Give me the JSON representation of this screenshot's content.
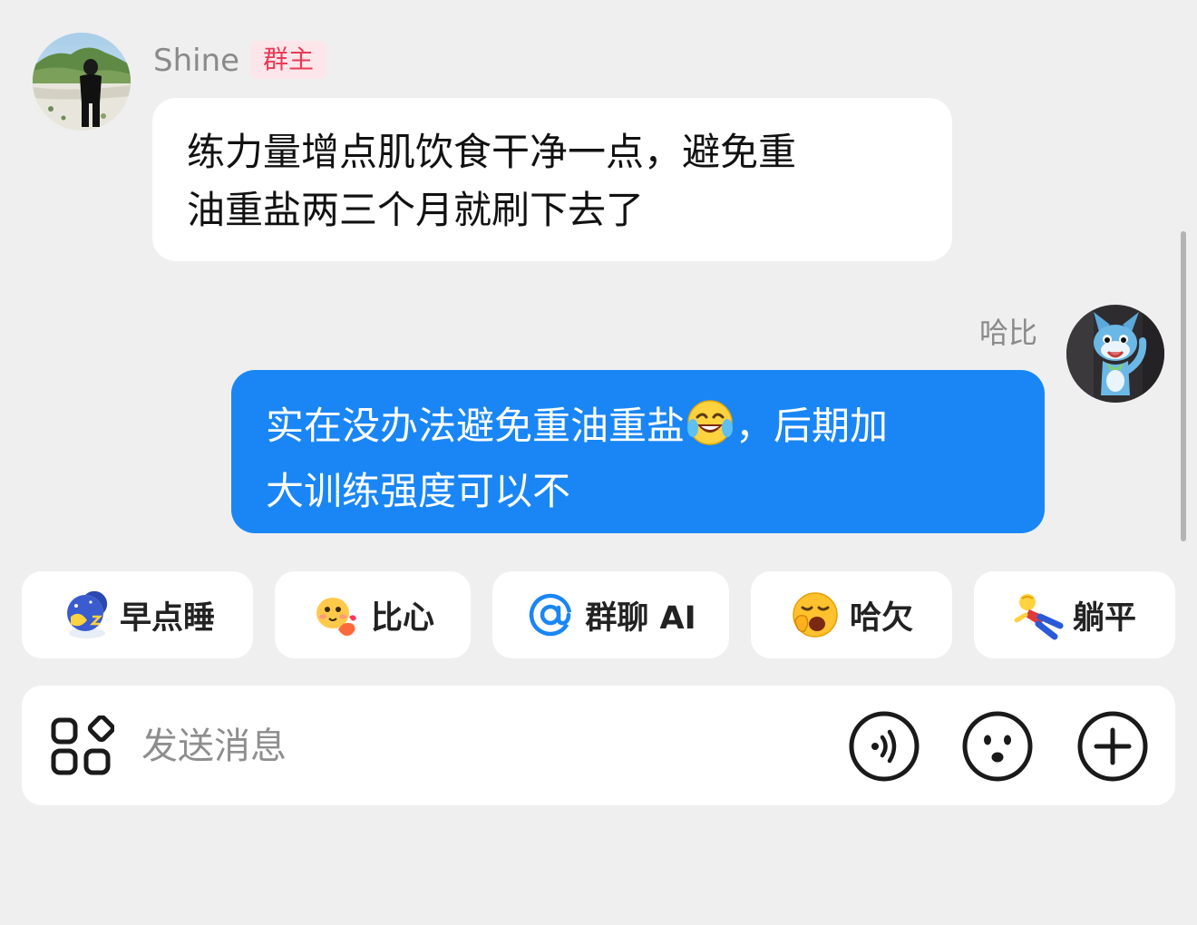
{
  "messages": {
    "incoming": {
      "sender": "Shine",
      "badge": "群主",
      "lines": [
        "练力量增点肌饮食干净一点，避免重",
        "油重盐两三个月就刷下去了"
      ]
    },
    "outgoing": {
      "sender": "哈比",
      "line1_before": "实在没办法避免重油重盐",
      "line1_after": "，后期加",
      "line2": "大训练强度可以不",
      "emoji": "crying-laughing-emoji"
    }
  },
  "quick_replies": [
    {
      "label": "早点睡",
      "icon": "sleeping-moon-icon"
    },
    {
      "label": "比心",
      "icon": "finger-heart-icon"
    },
    {
      "label": "群聊 AI",
      "icon": "at-sign-icon"
    },
    {
      "label": "哈欠",
      "icon": "yawning-face-icon"
    },
    {
      "label": "躺平",
      "icon": "lying-flat-icon"
    }
  ],
  "composer": {
    "placeholder": "发送消息"
  },
  "colors": {
    "outgoing_bubble": "#1a86f5",
    "badge_text": "#e83a56",
    "badge_bg": "#fde6ea",
    "background": "#efefef",
    "at_sign": "#1a86f5"
  }
}
